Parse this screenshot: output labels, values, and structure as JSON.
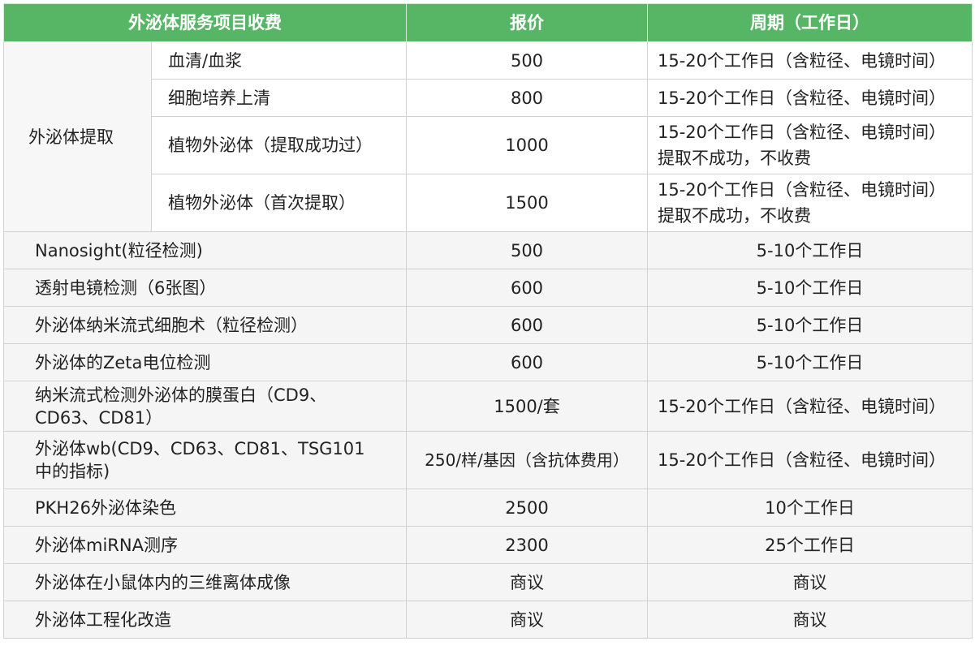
{
  "header": {
    "item": "外泌体服务项目收费",
    "price": "报价",
    "cycle": "周期（工作日）"
  },
  "extraction": {
    "group": "外泌体提取",
    "rows": [
      {
        "name": "血清/血浆",
        "price": "500",
        "cycle": "15-20个工作日（含粒径、电镜时间）",
        "note": ""
      },
      {
        "name": "细胞培养上清",
        "price": "800",
        "cycle": "15-20个工作日（含粒径、电镜时间）",
        "note": ""
      },
      {
        "name": "植物外泌体（提取成功过）",
        "price": "1000",
        "cycle": "15-20个工作日（含粒径、电镜时间）",
        "note": "提取不成功，不收费"
      },
      {
        "name": "植物外泌体（首次提取）",
        "price": "1500",
        "cycle": "15-20个工作日（含粒径、电镜时间）",
        "note": "提取不成功，不收费"
      }
    ]
  },
  "services": [
    {
      "name": "Nanosight(粒径检测)",
      "price": "500",
      "cycle": "5-10个工作日"
    },
    {
      "name": "透射电镜检测（6张图）",
      "price": "600",
      "cycle": "5-10个工作日"
    },
    {
      "name": "外泌体纳米流式细胞术（粒径检测）",
      "price": "600",
      "cycle": "5-10个工作日"
    },
    {
      "name": "外泌体的Zeta电位检测",
      "price": "600",
      "cycle": "5-10个工作日"
    },
    {
      "name_line1": "纳米流式检测外泌体的膜蛋白（CD9、",
      "name_line2": "CD63、CD81）",
      "price": "1500/套",
      "cycle": "15-20个工作日（含粒径、电镜时间）"
    },
    {
      "name_line1": "外泌体wb(CD9、CD63、CD81、TSG101",
      "name_line2": "中的指标)",
      "price": "250/样/基因（含抗体费用）",
      "cycle": "15-20个工作日（含粒径、电镜时间）"
    },
    {
      "name": "PKH26外泌体染色",
      "price": "2500",
      "cycle": "10个工作日"
    },
    {
      "name": "外泌体miRNA测序",
      "price": "2300",
      "cycle": "25个工作日"
    },
    {
      "name": "外泌体在小鼠体内的三维离体成像",
      "price": "商议",
      "cycle": "商议"
    },
    {
      "name": "外泌体工程化改造",
      "price": "商议",
      "cycle": "商议"
    }
  ]
}
